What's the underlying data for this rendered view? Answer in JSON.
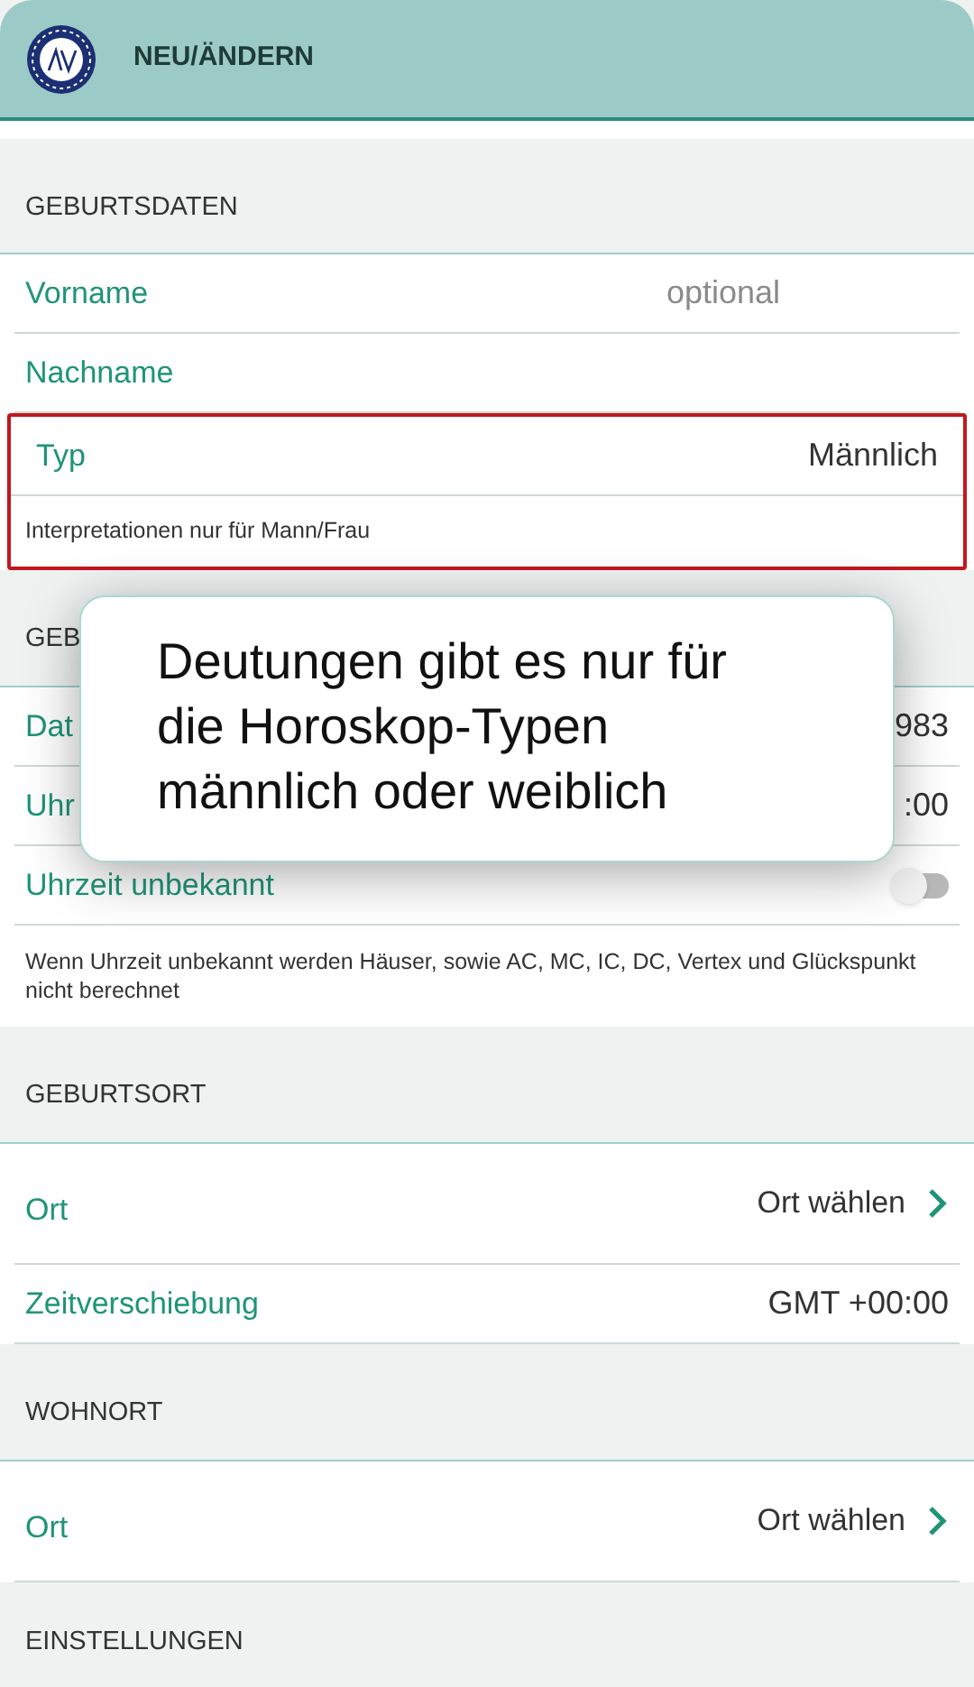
{
  "header": {
    "title": "NEU/ÄNDERN"
  },
  "sections": [
    {
      "title": "GEBURTSDATEN",
      "rows": [
        {
          "kind": "value",
          "label": "Vorname",
          "placeholder": "optional"
        },
        {
          "kind": "value",
          "label": "Nachname"
        },
        {
          "kind": "value",
          "label": "Typ",
          "value": "Männlich",
          "highlighted": true,
          "note": "Interpretationen nur für Mann/Frau"
        }
      ]
    },
    {
      "title": "GEB",
      "rows": [
        {
          "kind": "value",
          "label": "Dat",
          "value": "983"
        },
        {
          "kind": "value",
          "label": "Uhr",
          "value": ":00"
        },
        {
          "kind": "toggle",
          "label": "Uhrzeit unbekannt",
          "on": false
        }
      ],
      "note": "Wenn Uhrzeit unbekannt werden Häuser, sowie AC, MC, IC, DC, Vertex und Glückspunkt nicht berechnet"
    },
    {
      "title": "GEBURTSORT",
      "rows": [
        {
          "kind": "link",
          "label": "Ort",
          "value": "Ort wählen"
        },
        {
          "kind": "value",
          "label": "Zeitverschiebung",
          "value": "GMT +00:00"
        }
      ]
    },
    {
      "title": "WOHNORT",
      "rows": [
        {
          "kind": "link",
          "label": "Ort",
          "value": "Ort wählen"
        }
      ]
    },
    {
      "title": "EINSTELLUNGEN"
    }
  ],
  "tooltip": {
    "text": "Deutungen gibt es nur für die Horoskop-Typen männlich oder weiblich"
  }
}
